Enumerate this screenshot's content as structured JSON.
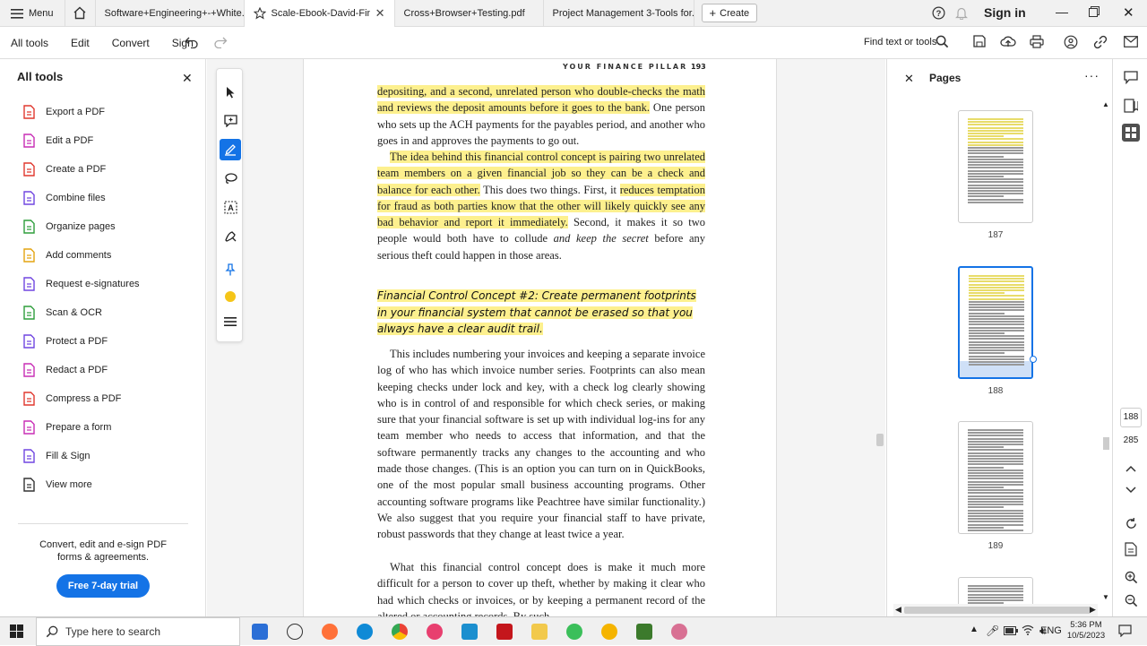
{
  "tabbar": {
    "menu_label": "Menu",
    "tabs": [
      {
        "label": "Software+Engineering+-+White..."
      },
      {
        "label": "Scale-Ebook-David-Fink..."
      },
      {
        "label": "Cross+Browser+Testing.pdf"
      },
      {
        "label": "Project Management 3-Tools for.."
      }
    ],
    "create_label": "Create",
    "signin_label": "Sign in"
  },
  "toolbar": {
    "items": [
      "All tools",
      "Edit",
      "Convert",
      "Sign"
    ],
    "find_label": "Find text or tools"
  },
  "left_panel": {
    "title": "All tools",
    "tools": [
      {
        "label": "Export a PDF",
        "icon": "export-pdf-icon",
        "color": "#e0382f"
      },
      {
        "label": "Edit a PDF",
        "icon": "edit-pdf-icon",
        "color": "#c82eb5"
      },
      {
        "label": "Create a PDF",
        "icon": "create-pdf-icon",
        "color": "#e0382f"
      },
      {
        "label": "Combine files",
        "icon": "combine-files-icon",
        "color": "#7046e0"
      },
      {
        "label": "Organize pages",
        "icon": "organize-pages-icon",
        "color": "#2e9e3c"
      },
      {
        "label": "Add comments",
        "icon": "add-comments-icon",
        "color": "#e3a411"
      },
      {
        "label": "Request e-signatures",
        "icon": "request-esignatures-icon",
        "color": "#7046e0"
      },
      {
        "label": "Scan & OCR",
        "icon": "scan-ocr-icon",
        "color": "#2e9e3c"
      },
      {
        "label": "Protect a PDF",
        "icon": "protect-pdf-icon",
        "color": "#7046e0"
      },
      {
        "label": "Redact a PDF",
        "icon": "redact-pdf-icon",
        "color": "#c82eb5"
      },
      {
        "label": "Compress a PDF",
        "icon": "compress-pdf-icon",
        "color": "#e0382f"
      },
      {
        "label": "Prepare a form",
        "icon": "prepare-form-icon",
        "color": "#c82eb5"
      },
      {
        "label": "Fill & Sign",
        "icon": "fill-sign-icon",
        "color": "#7046e0"
      },
      {
        "label": "View more",
        "icon": "view-more-icon",
        "color": "#333333"
      }
    ],
    "promo_text": "Convert, edit and e-sign PDF forms & agreements.",
    "trial_button": "Free 7-day trial"
  },
  "document": {
    "running_head": "YOUR FINANCE PILLAR",
    "page_number": "193",
    "p1_hl": "depositing, and a second, unrelated person who double-checks the math and reviews the deposit amounts before it goes to the bank.",
    "p1_rest": " One person who sets up the ACH payments for the payables period, and another who goes in and approves the payments to go out.",
    "p2_hl_a": "The idea behind this financial control concept is pairing two unrelated team members on a given financial job so they can be a check and balance for each other.",
    "p2_mid": " This does two things. First, it ",
    "p2_hl_b": "reduces temptation for fraud as both parties know that the other will likely quickly see any bad behavior and report it immediately.",
    "p2_rest_a": " Second, it makes it so two people would both have to collude ",
    "p2_italic": "and keep the secret",
    "p2_rest_b": " before any serious theft could happen in those areas.",
    "heading": "Financial Control Concept #2: Create permanent footprints in your financial system that cannot be erased so that you always have a clear audit trail.",
    "p3": "This includes numbering your invoices and keeping a separate invoice log of who has which invoice number series. Footprints can also mean keeping checks under lock and key, with a check log clearly showing who is in control of and responsible for which check series, or making sure that your financial software is set up with individual log-ins for any team member who needs to access that information, and that the software permanently tracks any changes to the accounting and who made those changes. (This is an option you can turn on in QuickBooks, one of the most popular small business accounting programs. Other accounting software programs like Peachtree have similar functionality.) We also suggest that you require your financial staff to have private, robust passwords that they change at least twice a year.",
    "p4": "What this financial control concept does is make it much more difficult for a person to cover up theft, whether by making it clear who had which checks or invoices, or by keeping a permanent record of the altered or accounting records. By such"
  },
  "pages_panel": {
    "title": "Pages",
    "thumbs": [
      {
        "label": "187"
      },
      {
        "label": "188"
      },
      {
        "label": "189"
      }
    ]
  },
  "right_rail": {
    "current_page": "188",
    "total_pages": "285"
  },
  "taskbar": {
    "search_placeholder": "Type here to search",
    "lang": "ENG",
    "time": "5:36 PM",
    "date": "10/5/2023"
  },
  "colors": {
    "accent": "#1473e6",
    "highlight": "#fdf08e"
  }
}
